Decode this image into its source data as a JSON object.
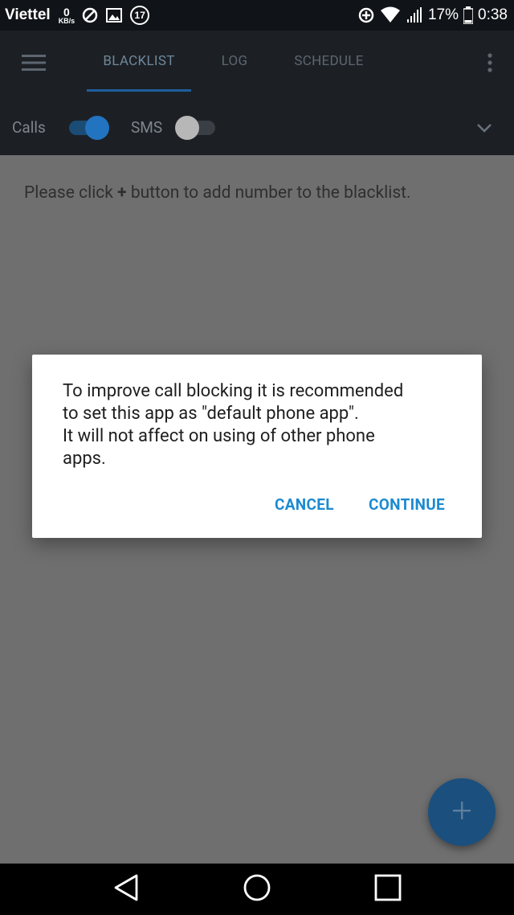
{
  "status_bar": {
    "carrier": "Viettel",
    "net_speed_value": "0",
    "net_speed_unit": "KB/s",
    "notification_count": "17",
    "battery": "17%",
    "time": "0:38"
  },
  "tabs": [
    {
      "label": "BLACKLIST",
      "active": true
    },
    {
      "label": "LOG",
      "active": false
    },
    {
      "label": "SCHEDULE",
      "active": false
    }
  ],
  "filters": {
    "calls": {
      "label": "Calls",
      "on": true
    },
    "sms": {
      "label": "SMS",
      "on": false
    }
  },
  "content": {
    "empty_before": "Please click ",
    "empty_plus": "+",
    "empty_after": " button to add number to the blacklist."
  },
  "dialog": {
    "lines": [
      "To improve call blocking it is recommended",
      "to set this app as \"default phone app\".",
      "It will not affect on using of other phone",
      "apps."
    ],
    "cancel_label": "CANCEL",
    "continue_label": "CONTINUE"
  },
  "colors": {
    "accent": "#1c8ad0",
    "fab": "#1b4f7e",
    "appbar": "#1c2025"
  },
  "icons": {
    "menu": "hamburger-icon",
    "more": "more-vert-icon",
    "expand": "chevron-down-icon",
    "fab": "plus-icon",
    "nav_back": "back-triangle-icon",
    "nav_home": "home-circle-icon",
    "nav_recents": "recents-square-icon"
  }
}
